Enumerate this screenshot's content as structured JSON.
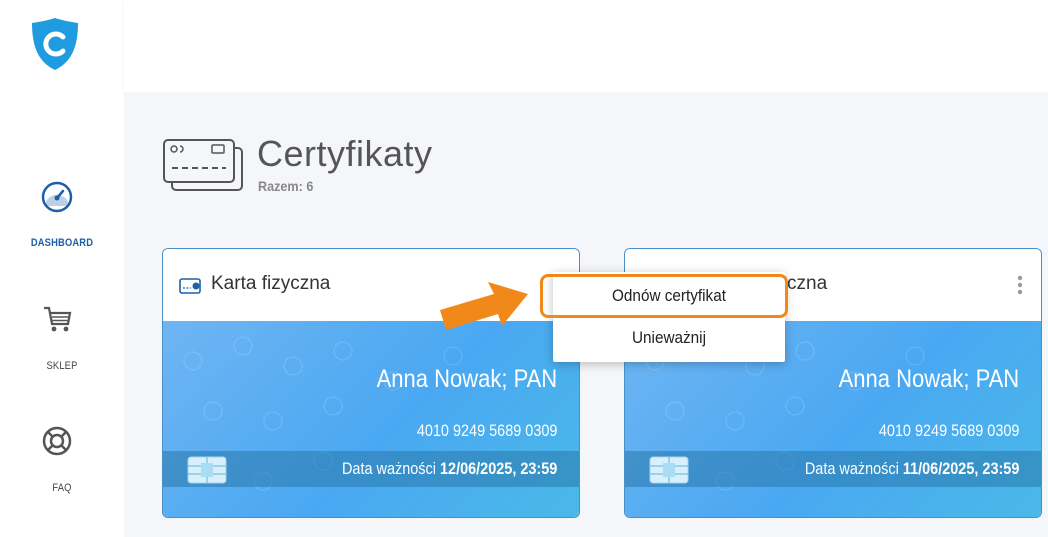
{
  "sidebar": {
    "items": [
      {
        "label": "DASHBOARD",
        "icon": "speedometer-icon",
        "active": true
      },
      {
        "label": "SKLEP",
        "icon": "cart-icon",
        "active": false
      },
      {
        "label": "FAQ",
        "icon": "lifebuoy-icon",
        "active": false
      }
    ],
    "logo_icon": "shield-c-logo-icon"
  },
  "page": {
    "title": "Certyfikaty",
    "subtitle": "Razem: 6",
    "icon": "cards-icon"
  },
  "cards": [
    {
      "type_label": "Karta fizyczna",
      "holder": "Anna Nowak; PAN",
      "number": "4010 9249 5689 0309",
      "expiry_prefix": "Data ważności",
      "expiry_value": "12/06/2025, 23:59"
    },
    {
      "type_label": "czna",
      "holder": "Anna Nowak; PAN",
      "number": "4010 9249 5689 0309",
      "expiry_prefix": "Data ważności",
      "expiry_value": "11/06/2025, 23:59"
    }
  ],
  "dropdown": {
    "items": [
      {
        "label": "Odnów certyfikat",
        "highlighted": true
      },
      {
        "label": "Unieważnij",
        "highlighted": false
      }
    ]
  },
  "colors": {
    "accent": "#1d5fa8",
    "highlight": "#f0891a",
    "card_gradient_start": "#6fb5f3",
    "card_gradient_end": "#49b9e8"
  }
}
